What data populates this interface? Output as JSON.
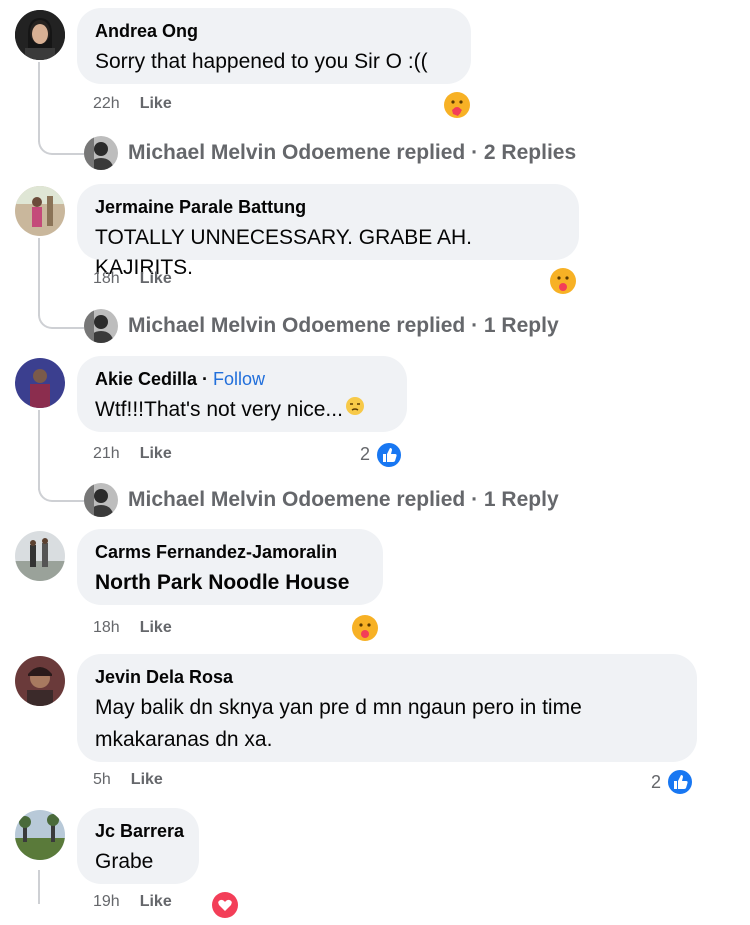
{
  "comments": [
    {
      "name": "Andrea Ong",
      "text": "Sorry that happened to you Sir O :((",
      "time": "22h",
      "like": "Like"
    },
    {
      "name": "Jermaine Parale Battung",
      "text": "TOTALLY UNNECESSARY. GRABE AH. KAJIRITS.",
      "time": "18h",
      "like": "Like"
    },
    {
      "name": "Akie Cedilla",
      "follow": "Follow",
      "text": "Wtf!!!That's not very nice...",
      "time": "21h",
      "like": "Like",
      "reaction_count": "2"
    },
    {
      "name": "Carms Fernandez-Jamoralin",
      "text": "North Park Noodle House",
      "time": "18h",
      "like": "Like"
    },
    {
      "name": "Jevin Dela Rosa",
      "text_line1": "May balik dn sknya yan pre d mn ngaun pero in time",
      "text_line2": "mkakaranas dn xa.",
      "time": "5h",
      "like": "Like",
      "reaction_count": "2"
    },
    {
      "name": "Jc Barrera",
      "text": "Grabe",
      "time": "19h",
      "like": "Like"
    }
  ],
  "replies": [
    {
      "text": "Michael Melvin Odoemene replied · 2 Replies"
    },
    {
      "text": "Michael Melvin Odoemene replied · 1 Reply"
    },
    {
      "text": "Michael Melvin Odoemene replied · 1 Reply"
    }
  ],
  "colors": {
    "bubble": "#f0f2f5",
    "secondary_text": "#65676b",
    "follow_link": "#216fdb",
    "like_blue": "#1877f2",
    "love_red": "#f33e58",
    "care_yellow": "#f7b125"
  }
}
